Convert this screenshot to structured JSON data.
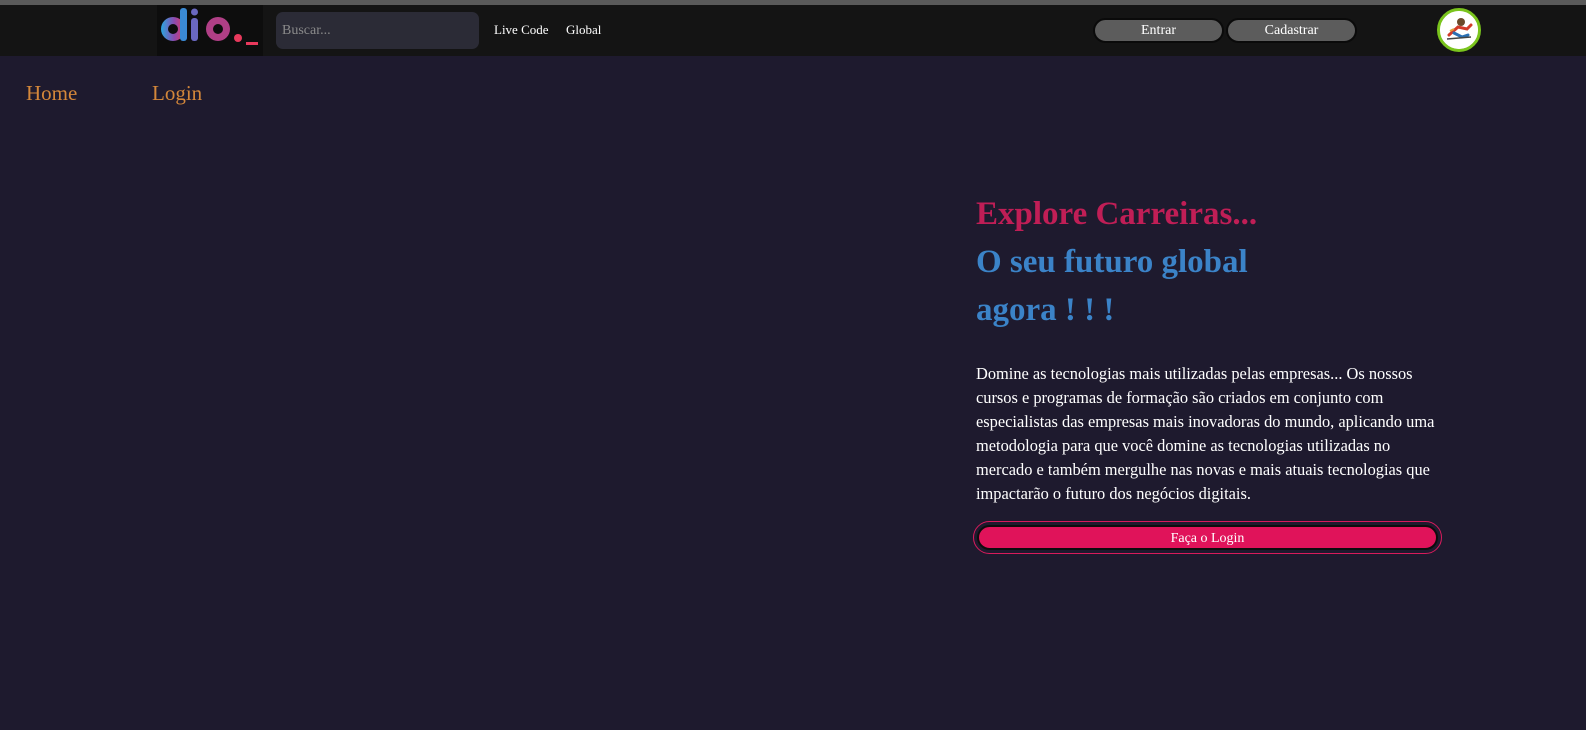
{
  "header": {
    "logo_text": "dio._",
    "search": {
      "placeholder": "Buscar...",
      "value": ""
    },
    "links": [
      "Live Code",
      "Global"
    ],
    "buttons": {
      "entrar": "Entrar",
      "cadastrar": "Cadastrar"
    },
    "avatar_icon": "user-avatar-icon"
  },
  "nav": {
    "home": "Home",
    "login": "Login"
  },
  "hero": {
    "title_line1": "Explore Carreiras...",
    "title_line2": "O seu futuro global",
    "title_line3": "agora ! ! !",
    "description": "Domine as tecnologias mais utilizadas pelas empresas... Os nossos cursos e programas de formação são criados em conjunto com especialistas das empresas mais inovadoras do mundo, aplicando uma metodologia para que você domine as tecnologias utilizadas no mercado e também mergulhe nas novas e mais atuais tecnologias que impactarão o futuro dos negócios digitais.",
    "cta": "Faça o Login"
  },
  "colors": {
    "background": "#1e1a2e",
    "header": "#141414",
    "nav_link": "#d4873a",
    "title_pink": "#c01e56",
    "title_blue": "#3b83c8",
    "cta": "#e0135a"
  }
}
